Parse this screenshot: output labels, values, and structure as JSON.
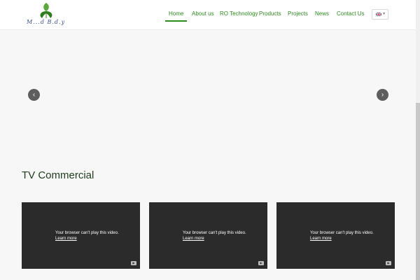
{
  "header": {
    "logo_text": "M...d  B.d.y",
    "nav": [
      {
        "label": "Home",
        "active": true
      },
      {
        "label": "About us",
        "active": false
      },
      {
        "label": "RO Technology",
        "active": false
      },
      {
        "label": "Products",
        "active": false
      },
      {
        "label": "Projects",
        "active": false
      },
      {
        "label": "News",
        "active": false
      },
      {
        "label": "Contact Us",
        "active": false
      }
    ],
    "language": {
      "icon": "uk-flag-icon",
      "caret": "▾"
    }
  },
  "slider": {
    "prev_icon": "chevron-left-icon",
    "next_icon": "chevron-right-icon",
    "prev_glyph": "‹",
    "next_glyph": "›"
  },
  "section": {
    "title": "TV Commercial",
    "videos": [
      {
        "message": "Your browser can't play this video.",
        "link": "Learn more"
      },
      {
        "message": "Your browser can't play this video.",
        "link": "Learn more"
      },
      {
        "message": "Your browser can't play this video.",
        "link": "Learn more"
      }
    ]
  },
  "colors": {
    "accent": "#2e8b1f",
    "video_bg": "#2b2b2b",
    "page_bg": "#f7f7f7"
  }
}
